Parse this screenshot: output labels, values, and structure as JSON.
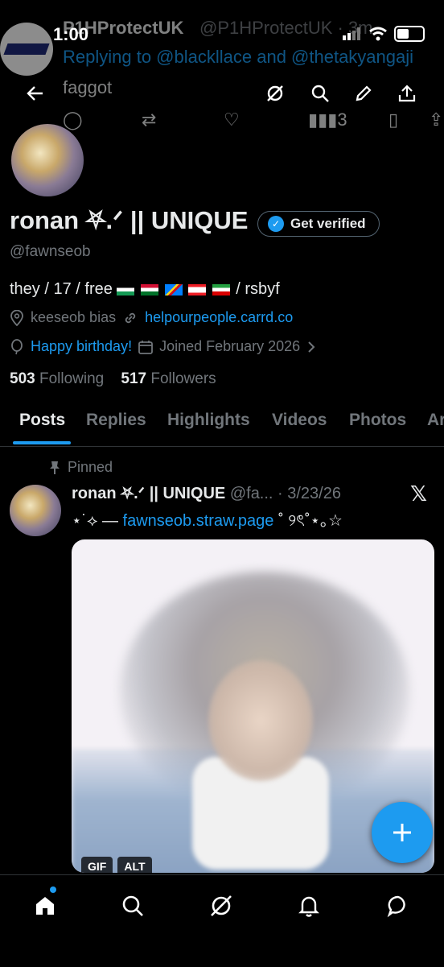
{
  "status_bar": {
    "time": "1:00"
  },
  "ghost_tweet": {
    "name": "P1HProtectUK",
    "handle": "@P1HProtectUK · 3m",
    "reply": "Replying to @blackllace and @thetakyangaji",
    "text": "faggot",
    "views": "3"
  },
  "profile": {
    "display_name": "ronan ⛧.ᐟ || UNIQUE",
    "verify_label": "Get verified",
    "handle": "@fawnseob",
    "bio": "they / 17 / free",
    "bio_suffix": "/ rsbyf",
    "location": "keeseob bias",
    "link": "helpourpeople.carrd.co",
    "birthday": "Happy birthday!",
    "joined": "Joined February 2026",
    "following_count": "503",
    "following_label": "Following",
    "followers_count": "517",
    "followers_label": "Followers"
  },
  "tabs": [
    {
      "label": "Posts"
    },
    {
      "label": "Replies"
    },
    {
      "label": "Highlights"
    },
    {
      "label": "Videos"
    },
    {
      "label": "Photos"
    },
    {
      "label": "Ar"
    }
  ],
  "pinned_post": {
    "pinned_label": "Pinned",
    "name": "ronan ⛧.ᐟ || UNIQUE",
    "meta": "@fa... · 3/23/26",
    "text_prefix": "⋆˙⟡ — ",
    "text_link": "fawnseob.straw.page",
    "text_suffix": " ˚ ୨ৎ˚⋆｡☆",
    "media_badges": [
      "GIF",
      "ALT"
    ]
  },
  "colors": {
    "accent": "#1d9bf0",
    "background": "#000000",
    "muted": "#71767b"
  },
  "icons": [
    "back-arrow-icon",
    "grok-icon",
    "search-icon",
    "edit-icon",
    "share-icon",
    "home-icon",
    "messages-icon",
    "notifications-icon",
    "x-logo-icon"
  ]
}
